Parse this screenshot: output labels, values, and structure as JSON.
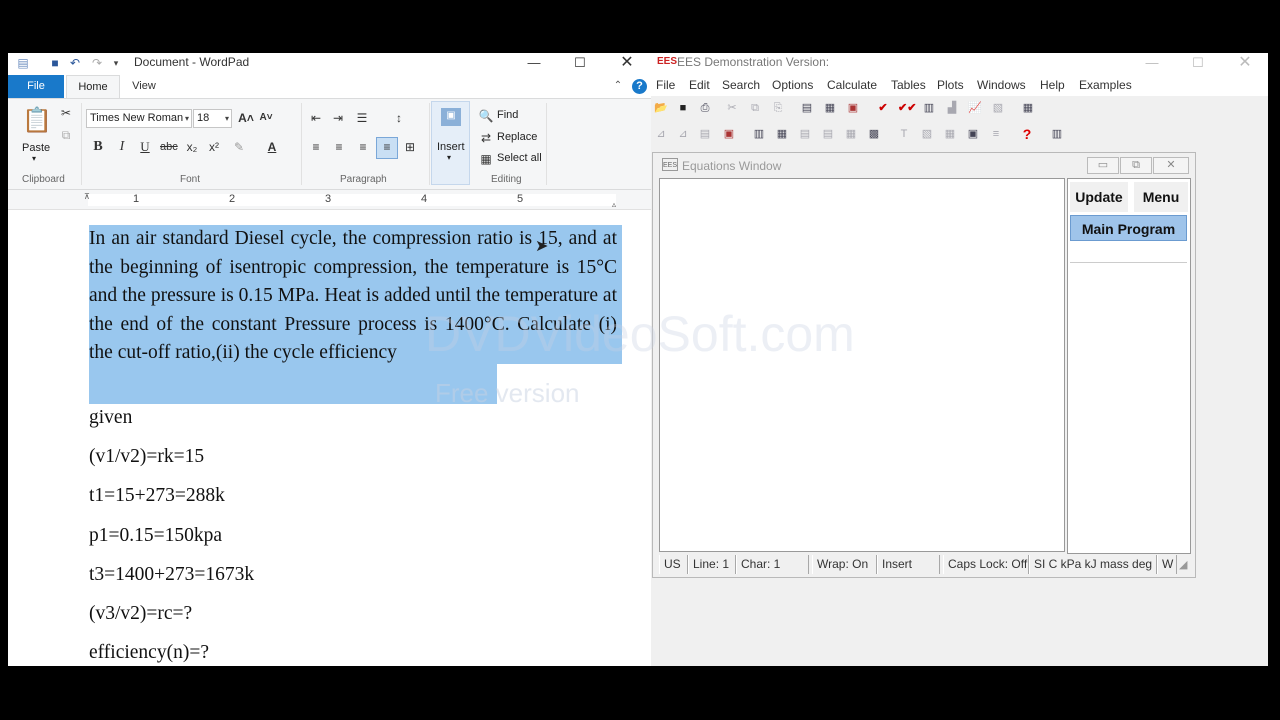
{
  "wordpad": {
    "title": "Document - WordPad",
    "tabs": {
      "file": "File",
      "home": "Home",
      "view": "View"
    },
    "ribbon": {
      "paste": "Paste",
      "clipboard": "Clipboard",
      "font_name": "Times New Roman",
      "font_size": "18",
      "font": "Font",
      "paragraph": "Paragraph",
      "insert": "Insert",
      "find": "Find",
      "replace": "Replace",
      "select_all": "Select all",
      "editing": "Editing"
    },
    "ruler_numbers": [
      "1",
      "2",
      "3",
      "4",
      "5"
    ],
    "document": {
      "selected_paragraph": "In an air standard Diesel cycle, the compression ratio is 15, and at the beginning of isentropic compression, the temperature is 15°C and the pressure is 0.15 MPa. Heat is added until the temperature at the end of the constant Pressure process is 1400°C. Calculate (i) the cut-off ratio,(ii) the cycle efficiency",
      "lines": [
        "given",
        "(v1/v2)=rk=15",
        "t1=15+273=288k",
        "p1=0.15=150kpa",
        "t3=1400+273=1673k",
        "(v3/v2)=rc=?",
        "efficiency(n)=?"
      ]
    },
    "watermark": {
      "brand": "DVDVideoSoft.com",
      "version": "Free version"
    }
  },
  "ees": {
    "title": "EES Demonstration Version:",
    "menu": [
      "File",
      "Edit",
      "Search",
      "Options",
      "Calculate",
      "Tables",
      "Plots",
      "Windows",
      "Help",
      "Examples"
    ],
    "equations_window": {
      "title": "Equations Window",
      "update": "Update",
      "menu": "Menu",
      "main_program": "Main Program",
      "status": {
        "units": "US",
        "line": "Line: 1",
        "char": "Char: 1",
        "wrap": "Wrap: On",
        "mode": "Insert",
        "caps": "Caps Lock: Off",
        "unit_system": "SI C kPa kJ mass deg",
        "extra": "W"
      }
    }
  }
}
